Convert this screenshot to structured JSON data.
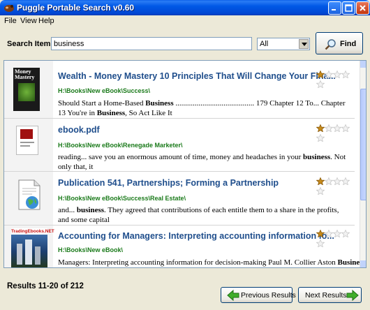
{
  "window": {
    "title": "Puggle Portable Search v0.60"
  },
  "menu": [
    "File",
    "View",
    "Help"
  ],
  "search": {
    "label": "Search Items :",
    "value": "business",
    "scope": "All",
    "find_label": "Find"
  },
  "results": [
    {
      "title": "Wealth - Money Mastery 10 Principles That Will Change Your Fina...",
      "path": "H:\\Books\\New eBook\\Success\\",
      "snippet": [
        {
          "t": "Should Start a Home-Based "
        },
        {
          "t": "Business",
          "b": true
        },
        {
          "t": " ......................................... 179 Chapter 12 To... Chapter 13 You're in "
        },
        {
          "t": "Business",
          "b": true
        },
        {
          "t": ", So Act Like It"
        }
      ],
      "rating": 1,
      "thumb": "money-mastery-cover"
    },
    {
      "title": "ebook.pdf",
      "path": "H:\\Books\\New eBook\\Renegade Marketer\\",
      "snippet": [
        {
          "t": "reading... save you an enormous amount of time, money and headaches in your "
        },
        {
          "t": "business",
          "b": true
        },
        {
          "t": ". Not only that, it"
        }
      ],
      "rating": 1,
      "thumb": "ebook-cover"
    },
    {
      "title": "Publication 541, Partnerships; Forming a Partnership",
      "path": "H:\\Books\\New eBook\\Success\\Real Estate\\",
      "snippet": [
        {
          "t": "and... "
        },
        {
          "t": "business",
          "b": true
        },
        {
          "t": ". They agreed that contributions of each entitle them to a share in the profits, and some capital"
        }
      ],
      "rating": 1,
      "thumb": "document-globe-icon"
    },
    {
      "title": "Accounting for Managers: Interpreting accounting information fo...",
      "path": "H:\\Books\\New eBook\\",
      "snippet": [
        {
          "t": "Managers: Interpreting accounting information for decision-making Paul M. Collier Aston "
        },
        {
          "t": "Business",
          "b": true
        }
      ],
      "rating": 1,
      "thumb": "tradingebooks-cover",
      "thumb_text": "TradingEbooks.NET"
    }
  ],
  "thumb_text_money": "Money Mastery",
  "status": "Results 11-20 of 212",
  "nav": {
    "prev": "Previous Results",
    "next": "Next Results"
  },
  "colors": {
    "title_link": "#1f4e8c",
    "path_green": "#1a7a1a",
    "star_filled": "#c68a1a",
    "star_empty": "#c8c8c8"
  }
}
